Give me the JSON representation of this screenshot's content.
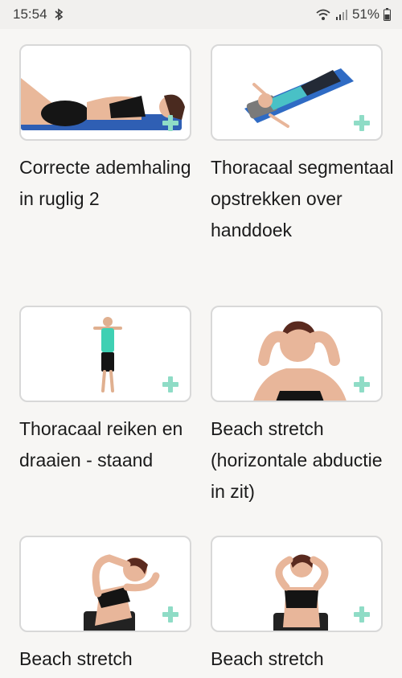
{
  "status_bar": {
    "time": "15:54",
    "battery": "51%",
    "icons": [
      "bluetooth-icon",
      "wifi-icon",
      "signal-icon",
      "battery-icon"
    ]
  },
  "exercises": [
    {
      "title": "Correcte ademhaling in ruglig 2",
      "thumbnail": "lying-breathing-figure"
    },
    {
      "title": "Thoracaal segmentaal opstrekken over handdoek",
      "thumbnail": "lying-towel-stretch-figure"
    },
    {
      "title": "Thoracaal reiken en draaien - staand",
      "thumbnail": "standing-reach-figure"
    },
    {
      "title": "Beach stretch (horizontale abductie in zit)",
      "thumbnail": "hands-behind-head-figure"
    },
    {
      "title": "Beach stretch",
      "thumbnail": "side-bend-seated-figure"
    },
    {
      "title": "Beach stretch",
      "thumbnail": "seated-hands-behind-head-figure"
    }
  ],
  "add_icon": "plus-icon",
  "accent_color": "#8fdcc6"
}
